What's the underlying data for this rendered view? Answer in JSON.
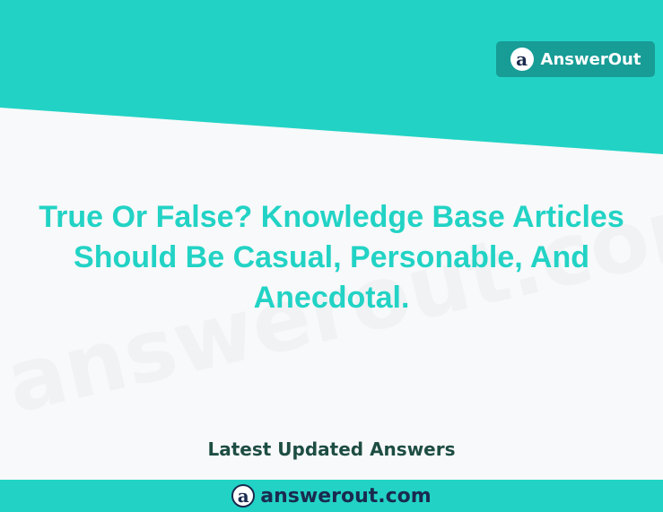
{
  "brand": {
    "name": "AnswerOut",
    "logo_letter": "a",
    "logo_icon": "answerout-logo-icon"
  },
  "headline": "True Or False? Knowledge Base Articles Should Be Casual, Personable, And Anecdotal.",
  "watermark": "answerout.com",
  "subheading": "Latest Updated Answers",
  "footer": {
    "url": "answerout.com",
    "logo_letter": "a"
  },
  "colors": {
    "accent": "#22d3c5",
    "badge_bg": "#179c96",
    "logo_navy": "#1a2a4f",
    "background": "#f8f9fa",
    "subhead_text": "#1d4d43",
    "footer_text": "#1a2a4f",
    "watermark": "#b8c2cc"
  }
}
